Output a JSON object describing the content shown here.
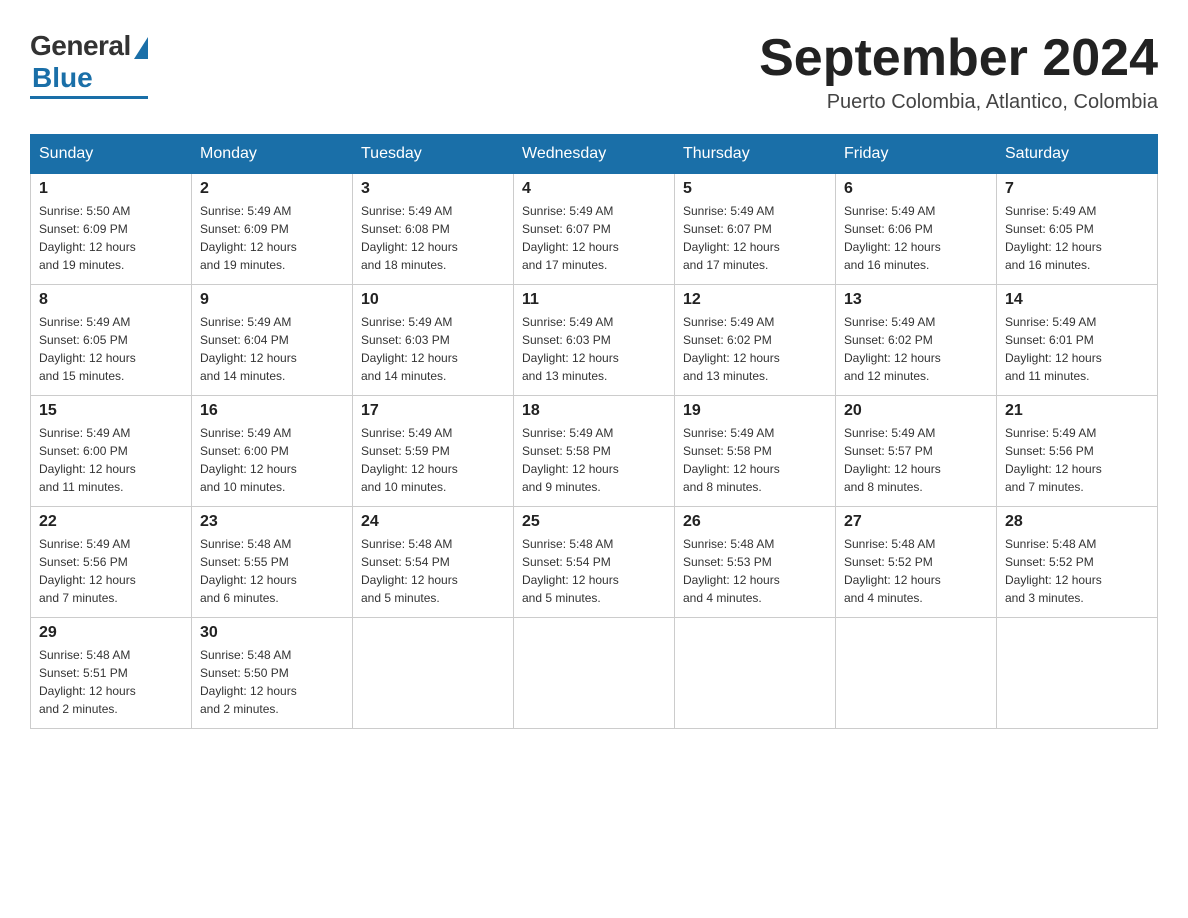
{
  "header": {
    "logo_general": "General",
    "logo_blue": "Blue",
    "month_title": "September 2024",
    "location": "Puerto Colombia, Atlantico, Colombia"
  },
  "weekdays": [
    "Sunday",
    "Monday",
    "Tuesday",
    "Wednesday",
    "Thursday",
    "Friday",
    "Saturday"
  ],
  "weeks": [
    [
      {
        "day": "1",
        "sunrise": "5:50 AM",
        "sunset": "6:09 PM",
        "daylight": "12 hours and 19 minutes."
      },
      {
        "day": "2",
        "sunrise": "5:49 AM",
        "sunset": "6:09 PM",
        "daylight": "12 hours and 19 minutes."
      },
      {
        "day": "3",
        "sunrise": "5:49 AM",
        "sunset": "6:08 PM",
        "daylight": "12 hours and 18 minutes."
      },
      {
        "day": "4",
        "sunrise": "5:49 AM",
        "sunset": "6:07 PM",
        "daylight": "12 hours and 17 minutes."
      },
      {
        "day": "5",
        "sunrise": "5:49 AM",
        "sunset": "6:07 PM",
        "daylight": "12 hours and 17 minutes."
      },
      {
        "day": "6",
        "sunrise": "5:49 AM",
        "sunset": "6:06 PM",
        "daylight": "12 hours and 16 minutes."
      },
      {
        "day": "7",
        "sunrise": "5:49 AM",
        "sunset": "6:05 PM",
        "daylight": "12 hours and 16 minutes."
      }
    ],
    [
      {
        "day": "8",
        "sunrise": "5:49 AM",
        "sunset": "6:05 PM",
        "daylight": "12 hours and 15 minutes."
      },
      {
        "day": "9",
        "sunrise": "5:49 AM",
        "sunset": "6:04 PM",
        "daylight": "12 hours and 14 minutes."
      },
      {
        "day": "10",
        "sunrise": "5:49 AM",
        "sunset": "6:03 PM",
        "daylight": "12 hours and 14 minutes."
      },
      {
        "day": "11",
        "sunrise": "5:49 AM",
        "sunset": "6:03 PM",
        "daylight": "12 hours and 13 minutes."
      },
      {
        "day": "12",
        "sunrise": "5:49 AM",
        "sunset": "6:02 PM",
        "daylight": "12 hours and 13 minutes."
      },
      {
        "day": "13",
        "sunrise": "5:49 AM",
        "sunset": "6:02 PM",
        "daylight": "12 hours and 12 minutes."
      },
      {
        "day": "14",
        "sunrise": "5:49 AM",
        "sunset": "6:01 PM",
        "daylight": "12 hours and 11 minutes."
      }
    ],
    [
      {
        "day": "15",
        "sunrise": "5:49 AM",
        "sunset": "6:00 PM",
        "daylight": "12 hours and 11 minutes."
      },
      {
        "day": "16",
        "sunrise": "5:49 AM",
        "sunset": "6:00 PM",
        "daylight": "12 hours and 10 minutes."
      },
      {
        "day": "17",
        "sunrise": "5:49 AM",
        "sunset": "5:59 PM",
        "daylight": "12 hours and 10 minutes."
      },
      {
        "day": "18",
        "sunrise": "5:49 AM",
        "sunset": "5:58 PM",
        "daylight": "12 hours and 9 minutes."
      },
      {
        "day": "19",
        "sunrise": "5:49 AM",
        "sunset": "5:58 PM",
        "daylight": "12 hours and 8 minutes."
      },
      {
        "day": "20",
        "sunrise": "5:49 AM",
        "sunset": "5:57 PM",
        "daylight": "12 hours and 8 minutes."
      },
      {
        "day": "21",
        "sunrise": "5:49 AM",
        "sunset": "5:56 PM",
        "daylight": "12 hours and 7 minutes."
      }
    ],
    [
      {
        "day": "22",
        "sunrise": "5:49 AM",
        "sunset": "5:56 PM",
        "daylight": "12 hours and 7 minutes."
      },
      {
        "day": "23",
        "sunrise": "5:48 AM",
        "sunset": "5:55 PM",
        "daylight": "12 hours and 6 minutes."
      },
      {
        "day": "24",
        "sunrise": "5:48 AM",
        "sunset": "5:54 PM",
        "daylight": "12 hours and 5 minutes."
      },
      {
        "day": "25",
        "sunrise": "5:48 AM",
        "sunset": "5:54 PM",
        "daylight": "12 hours and 5 minutes."
      },
      {
        "day": "26",
        "sunrise": "5:48 AM",
        "sunset": "5:53 PM",
        "daylight": "12 hours and 4 minutes."
      },
      {
        "day": "27",
        "sunrise": "5:48 AM",
        "sunset": "5:52 PM",
        "daylight": "12 hours and 4 minutes."
      },
      {
        "day": "28",
        "sunrise": "5:48 AM",
        "sunset": "5:52 PM",
        "daylight": "12 hours and 3 minutes."
      }
    ],
    [
      {
        "day": "29",
        "sunrise": "5:48 AM",
        "sunset": "5:51 PM",
        "daylight": "12 hours and 2 minutes."
      },
      {
        "day": "30",
        "sunrise": "5:48 AM",
        "sunset": "5:50 PM",
        "daylight": "12 hours and 2 minutes."
      },
      null,
      null,
      null,
      null,
      null
    ]
  ],
  "labels": {
    "sunrise": "Sunrise:",
    "sunset": "Sunset:",
    "daylight": "Daylight:"
  }
}
